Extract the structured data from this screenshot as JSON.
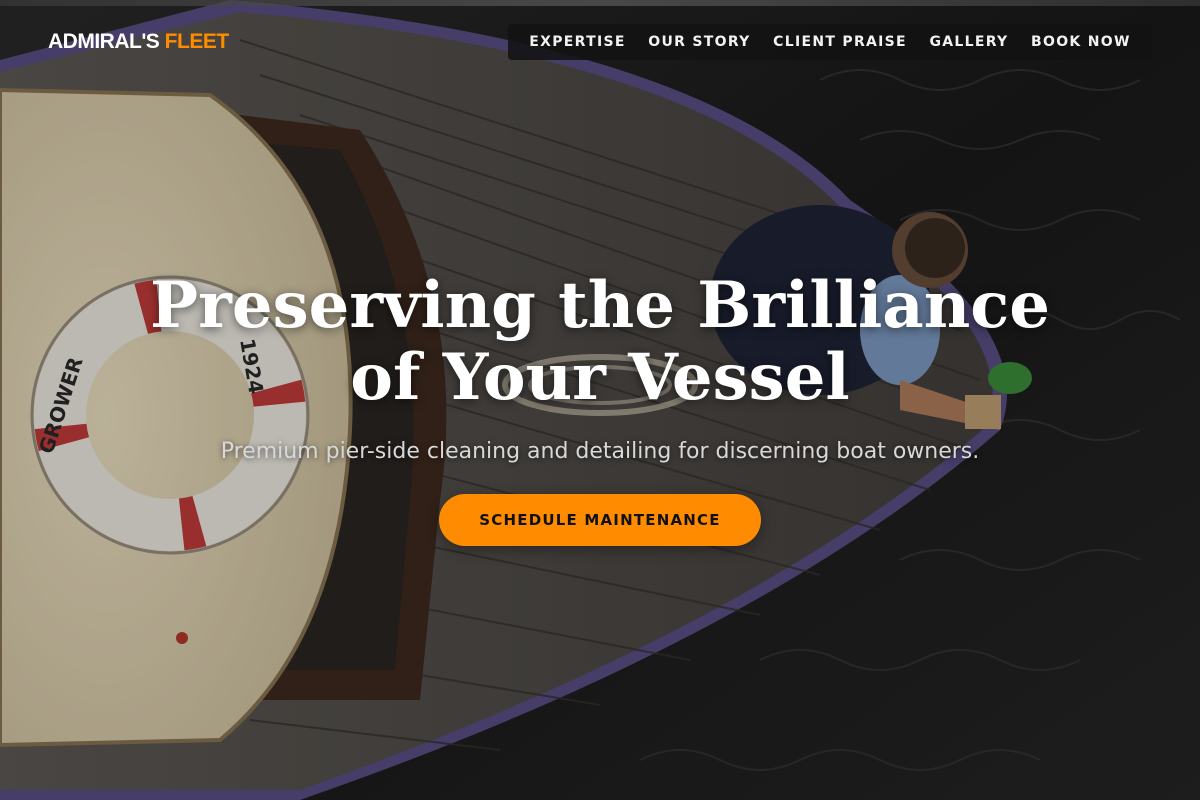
{
  "brand": {
    "name_primary": "ADMIRAL'S",
    "name_accent": "FLEET",
    "accent_color": "#ff8c00"
  },
  "nav": {
    "items": [
      {
        "label": "EXPERTISE"
      },
      {
        "label": "OUR STORY"
      },
      {
        "label": "CLIENT PRAISE"
      },
      {
        "label": "GALLERY"
      },
      {
        "label": "BOOK NOW"
      }
    ]
  },
  "hero": {
    "headline_line1": "Preserving the Brilliance",
    "headline_line2": "of Your Vessel",
    "subheadline": "Premium pier-side cleaning and detailing for discerning boat owners.",
    "cta_label": "SCHEDULE MAINTENANCE",
    "background_image": "overhead photo of wooden boat deck with life ring and a man cleaning, dark water",
    "life_ring_text_1": "GROWER",
    "life_ring_text_2": "1924"
  },
  "colors": {
    "cta_background": "#ff8c00",
    "nav_background": "#121212",
    "text": "#ffffff"
  }
}
